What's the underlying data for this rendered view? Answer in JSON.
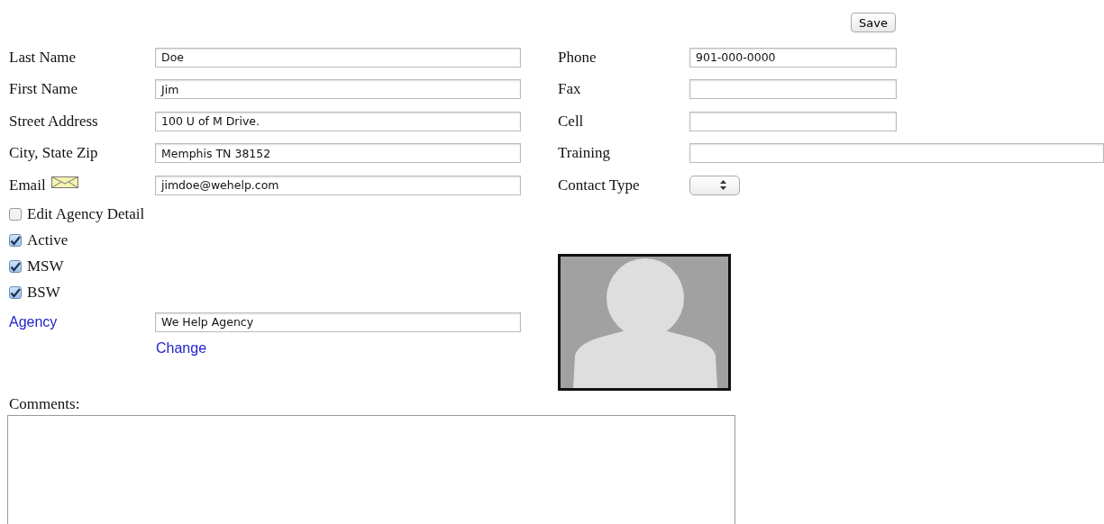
{
  "save_button": "Save",
  "left_fields": [
    {
      "kind": "text",
      "label": "Last Name",
      "value": "Doe"
    },
    {
      "kind": "text",
      "label": "First Name",
      "value": "Jim"
    },
    {
      "kind": "text",
      "label": "Street Address",
      "value": "100 U of M Drive."
    },
    {
      "kind": "text",
      "label": "City, State Zip",
      "value": "Memphis TN 38152"
    },
    {
      "kind": "email",
      "label": "Email",
      "value": "jimdoe@wehelp.com"
    }
  ],
  "checkboxes": [
    {
      "label": "Edit Agency Detail",
      "checked": false
    },
    {
      "label": "Active",
      "checked": true
    },
    {
      "label": "MSW",
      "checked": true
    },
    {
      "label": "BSW",
      "checked": true
    }
  ],
  "agency": {
    "label": "Agency",
    "value": "We Help Agency",
    "change_link": "Change"
  },
  "right_fields": [
    {
      "kind": "text",
      "label": "Phone",
      "value": "901-000-0000"
    },
    {
      "kind": "text",
      "label": "Fax"
    },
    {
      "kind": "text",
      "label": "Cell"
    },
    {
      "kind": "wide",
      "label": "Training"
    },
    {
      "kind": "select",
      "label": "Contact Type"
    }
  ],
  "comments": {
    "label": "Comments:"
  }
}
